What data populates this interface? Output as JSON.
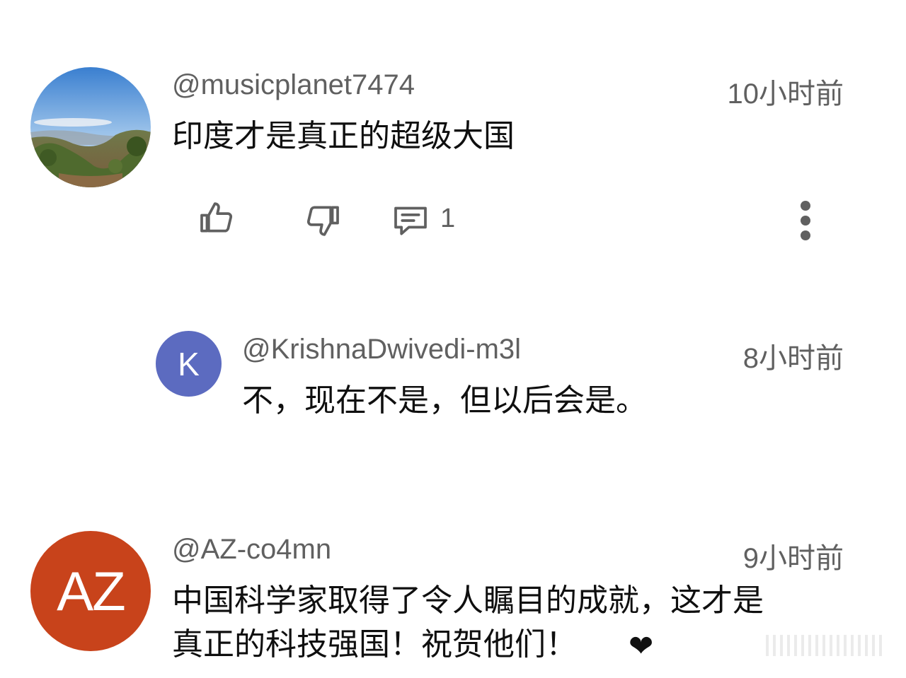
{
  "comments": [
    {
      "handle": "@musicplanet7474",
      "time": "10小时前",
      "text": "印度才是真正的超级大国",
      "avatar": {
        "type": "photo",
        "description_icon": "landscape-photo-avatar"
      },
      "actions": {
        "like_icon": "thumbs-up-icon",
        "dislike_icon": "thumbs-down-icon",
        "reply_icon": "comment-icon",
        "reply_count": "1",
        "menu_icon": "more-vertical-icon"
      }
    },
    {
      "handle": "@KrishnaDwivedi-m3l",
      "time": "8小时前",
      "text": "不，现在不是，但以后会是。",
      "avatar": {
        "type": "letter",
        "letter": "K",
        "color": "#5c6bc0"
      }
    },
    {
      "handle": "@AZ-co4mn",
      "time": "9小时前",
      "text_lines": [
        "中国科学家取得了令人瞩目的成就，这才是",
        "真正的科技强国！祝贺他们！"
      ],
      "emoji": "❤",
      "avatar": {
        "type": "letter",
        "letter": "AZ",
        "color": "#c8431b"
      }
    }
  ],
  "colors": {
    "secondary_text": "#606060",
    "primary_text": "#0f0f0f",
    "background": "#ffffff"
  }
}
